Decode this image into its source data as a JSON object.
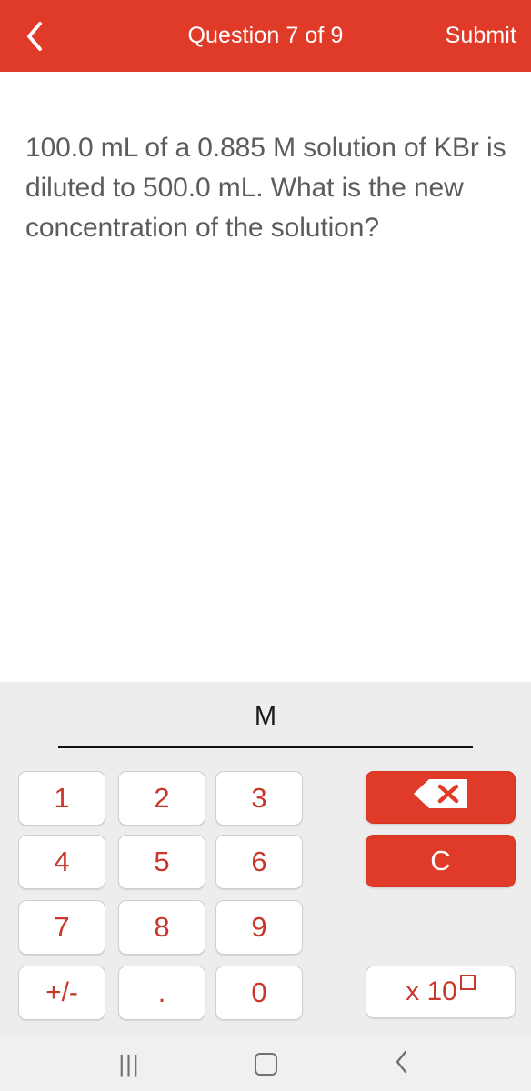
{
  "header": {
    "back_icon": "chevron-left-icon",
    "title": "Question 7 of 9",
    "submit_label": "Submit",
    "bg_color": "#e03b28",
    "text_color": "#ffffff"
  },
  "question": {
    "text": "100.0 mL of a 0.885 M solution of KBr is diluted to 500.0 mL. What is the new concentration of the solution?",
    "text_color": "#5c5c5c"
  },
  "answer": {
    "value": "",
    "unit": "M",
    "underline_color": "#111111"
  },
  "keypad": {
    "bg_color": "#ededed",
    "key_text_color": "#c8372a",
    "action_bg_color": "#e03b28",
    "rows": [
      [
        "1",
        "2",
        "3"
      ],
      [
        "4",
        "5",
        "6"
      ],
      [
        "7",
        "8",
        "9"
      ],
      [
        "+/-",
        ".",
        "0"
      ]
    ],
    "backspace_icon": "backspace-delete-icon",
    "clear_label": "C",
    "sci_prefix": "x 10",
    "sci_exponent_placeholder": ""
  },
  "navbar": {
    "recents_glyph": "|||",
    "recents_icon": "recents-icon",
    "home_icon": "home-icon",
    "back_icon": "nav-back-icon",
    "glyph_color": "#6e7277"
  }
}
